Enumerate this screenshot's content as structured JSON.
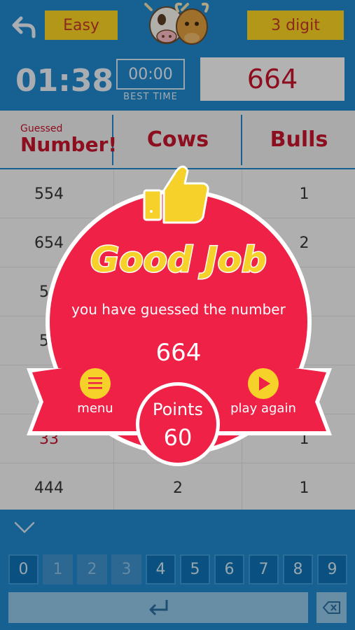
{
  "header": {
    "difficulty": "Easy",
    "digits": "3 digit"
  },
  "timer": {
    "elapsed": "01:38",
    "best_time": "00:00",
    "best_time_label": "BEST TIME",
    "secret_number": "664"
  },
  "table": {
    "col_guessed_small": "Guessed",
    "col_guessed": "Number!",
    "col_cows": "Cows",
    "col_bulls": "Bulls",
    "rows": [
      {
        "guess": "554",
        "cows": "",
        "bulls": "1"
      },
      {
        "guess": "654",
        "cows": "",
        "bulls": "2"
      },
      {
        "guess": "54",
        "cows": "",
        "bulls": ""
      },
      {
        "guess": "56",
        "cows": "",
        "bulls": ""
      },
      {
        "guess": "",
        "cows": "",
        "bulls": ""
      },
      {
        "guess": "33",
        "cows": "",
        "bulls": "1"
      },
      {
        "guess": "444",
        "cows": "2",
        "bulls": "1"
      }
    ]
  },
  "keypad": {
    "keys": [
      "0",
      "1",
      "2",
      "3",
      "4",
      "5",
      "6",
      "7",
      "8",
      "9"
    ],
    "used_keys": [
      "1",
      "2",
      "3"
    ]
  },
  "popup": {
    "title": "Good Job",
    "subtitle": "you have guessed the number",
    "number": "664",
    "menu_label": "menu",
    "play_again_label": "play again",
    "points_label": "Points",
    "points_value": "60"
  },
  "colors": {
    "header_blue": "#1f86c8",
    "accent_yellow": "#f4d021",
    "popup_red": "#ef2147",
    "text_red": "#c0142b"
  },
  "icons": [
    "back-arrow-icon",
    "cow-bull-logo",
    "thumbs-up-icon",
    "menu-icon",
    "play-icon",
    "chevron-down-icon",
    "enter-icon",
    "backspace-icon"
  ]
}
